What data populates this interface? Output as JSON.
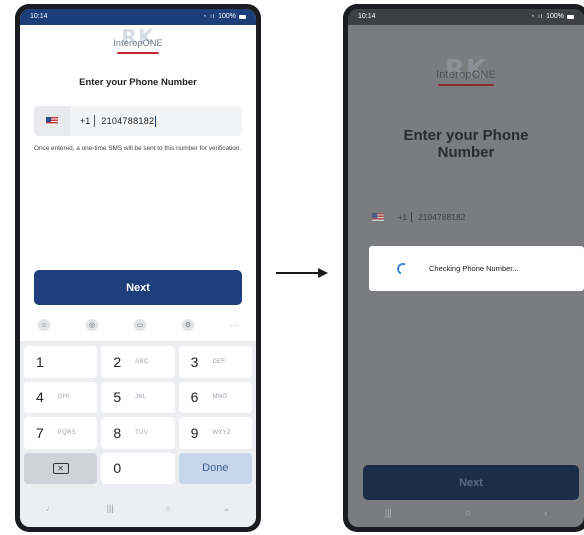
{
  "left": {
    "status": {
      "time": "10:14",
      "battery": "100%"
    },
    "logo": {
      "watermark": "RK",
      "brand": "InteropONE"
    },
    "title": "Enter your Phone Number",
    "phone": {
      "dial_code": "+1",
      "number": "2104788182"
    },
    "helper": "Once entered, a one-time SMS will be sent to this number for verification.",
    "next_label": "Next",
    "keypad": {
      "k1": "1",
      "k2": "2",
      "k2sub": "ABC",
      "k3": "3",
      "k3sub": "DEF",
      "k4": "4",
      "k4sub": "GHI",
      "k5": "5",
      "k5sub": "JKL",
      "k6": "6",
      "k6sub": "MNO",
      "k7": "7",
      "k7sub": "PQRS",
      "k8": "8",
      "k8sub": "TUV",
      "k9": "9",
      "k9sub": "WXYZ",
      "k0": "0",
      "done": "Done"
    }
  },
  "right": {
    "status": {
      "time": "10:14",
      "battery": "100%"
    },
    "logo": {
      "watermark": "RK",
      "brand": "InteropONE"
    },
    "title_line1": "Enter your Phone",
    "title_line2": "Number",
    "phone": {
      "dial_code": "+1",
      "number": "2104788182"
    },
    "dialog_text": "Checking Phone Number...",
    "next_label": "Next"
  },
  "icons": {
    "flag": "us-flag-icon",
    "backspace": "backspace-icon",
    "spinner": "spinner-icon"
  },
  "colors": {
    "primary": "#1e3f7c",
    "overlay": "#7a7c80",
    "spinner": "#3b8ad9"
  }
}
